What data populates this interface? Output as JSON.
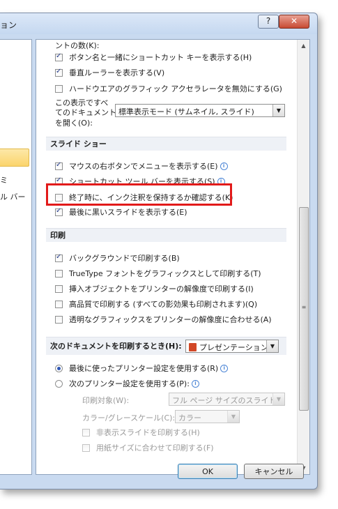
{
  "window": {
    "title": "ョン",
    "help_label": "?",
    "close_label": "✕"
  },
  "left_nav": {
    "item1": "ミ",
    "item2": "ル バー"
  },
  "top_items": [
    {
      "label": "ントの数(K):",
      "checked": false,
      "partial": true
    },
    {
      "label": "ボタン名と一緒にショートカット キーを表示する(H)",
      "checked": true
    },
    {
      "label": "垂直ルーラーを表示する(V)",
      "checked": true
    },
    {
      "label": "ハードウエアのグラフィック アクセラレータを無効にする(G)",
      "checked": false
    }
  ],
  "view_setting": {
    "label_line1": "この表示ですべ",
    "label_line2": "てのドキュメント",
    "label_line3": "を開く(O):",
    "value": "標準表示モード (サムネイル, スライド)"
  },
  "slideshow": {
    "header": "スライド ショー",
    "items": [
      {
        "label": "マウスの右ボタンでメニューを表示する(E)",
        "checked": true,
        "info": true
      },
      {
        "label": "ショートカット ツール バーを表示する(S)",
        "checked": true,
        "info": true
      },
      {
        "label": "終了時に、インク注釈を保持するか確認する(K)",
        "checked": false,
        "info": false
      },
      {
        "label": "最後に黒いスライドを表示する(E)",
        "checked": true,
        "info": false
      }
    ]
  },
  "print": {
    "header": "印刷",
    "items": [
      {
        "label": "バックグラウンドで印刷する(B)",
        "checked": true
      },
      {
        "label": "TrueType フォントをグラフィックスとして印刷する(T)",
        "checked": false
      },
      {
        "label": "挿入オブジェクトをプリンターの解像度で印刷する(I)",
        "checked": false
      },
      {
        "label": "高品質で印刷する (すべての影効果も印刷されます)(Q)",
        "checked": false
      },
      {
        "label": "透明なグラフィックスをプリンターの解像度に合わせる(A)",
        "checked": false
      }
    ]
  },
  "print_doc": {
    "header": "次のドキュメントを印刷するとき(H):",
    "doc_value": "プレゼンテーション1",
    "radio1": "最後に使ったプリンター設定を使用する(R)",
    "radio2": "次のプリンター設定を使用する(P):",
    "what_label": "印刷対象(W):",
    "what_value": "フル ページ サイズのスライド",
    "color_label": "カラー/グレースケール(C):",
    "color_value": "カラー",
    "hidden_label": "非表示スライドを印刷する(H)",
    "scale_label": "用紙サイズに合わせて印刷する(F)"
  },
  "buttons": {
    "ok": "OK",
    "cancel": "キャンセル"
  },
  "colors": {
    "highlight": "#e21a1a",
    "section_bg": "#eef1f6",
    "selected_nav": "#fbd46c"
  }
}
